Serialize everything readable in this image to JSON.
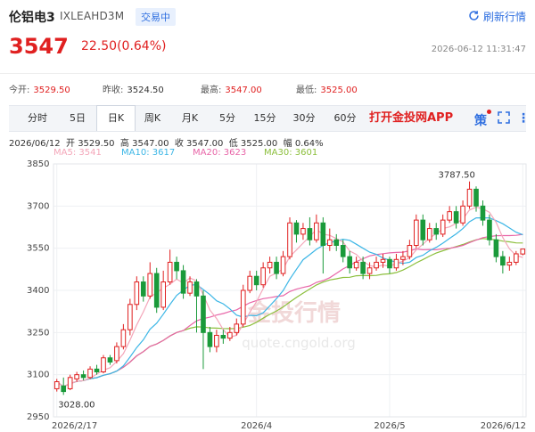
{
  "header": {
    "title": "伦铝电3",
    "code": "IXLEAHD3M",
    "status_badge": "交易中",
    "refresh_label": "刷新行情"
  },
  "quote": {
    "price": "3547",
    "change": "22.50(0.64%)",
    "timestamp": "2026-06-12 11:31:47",
    "open_label": "今开:",
    "open": "3529.50",
    "prev_close_label": "昨收:",
    "prev_close": "3524.50",
    "high_label": "最高:",
    "high": "3547.00",
    "low_label": "最低:",
    "low": "3525.00"
  },
  "tabs": [
    "分时",
    "5日",
    "日K",
    "周K",
    "月K",
    "5分",
    "15分",
    "30分",
    "60分"
  ],
  "active_tab": "日K",
  "app_link": "打开金投网APP",
  "kline_info": {
    "date": "2026/06/12",
    "open_label": "开",
    "open": "3529.50",
    "high_label": "高",
    "high": "3547.00",
    "close_label": "收",
    "close": "3547.00",
    "low_label": "低",
    "low": "3525.00",
    "amp_label": "幅",
    "amp": "0.64%"
  },
  "ma_legend": {
    "ma5": "MA5: 3541",
    "ma10": "MA10: 3617",
    "ma20": "MA20: 3623",
    "ma30": "MA30: 3601"
  },
  "watermark": {
    "text": "金投行情",
    "url": "quote.cngold.org"
  },
  "colors": {
    "up": "#e02020",
    "down": "#1a9a3a",
    "ma5": "#f4a6b9",
    "ma10": "#3cb6e6",
    "ma20": "#e866a8",
    "ma30": "#8cbf3c",
    "accent": "#2f6fe0"
  },
  "chart_data": {
    "type": "candlestick",
    "ylim": [
      2950,
      3850
    ],
    "y_ticks": [
      2950,
      3100,
      3250,
      3400,
      3550,
      3700,
      3850
    ],
    "x_labels": [
      {
        "index": 0,
        "label": "2026/2/17"
      },
      {
        "index": 30,
        "label": "2026/4"
      },
      {
        "index": 50,
        "label": "2026/5"
      },
      {
        "index": 70,
        "label": "2026/6/12"
      }
    ],
    "max_annotation": {
      "index": 62,
      "value": "3787.50"
    },
    "min_annotation": {
      "index": 1,
      "value": "3028.00"
    },
    "candles": [
      [
        3050,
        3075,
        3040,
        3085
      ],
      [
        3060,
        3040,
        3028,
        3090
      ],
      [
        3050,
        3090,
        3045,
        3100
      ],
      [
        3085,
        3100,
        3075,
        3110
      ],
      [
        3100,
        3090,
        3080,
        3115
      ],
      [
        3090,
        3120,
        3085,
        3130
      ],
      [
        3120,
        3110,
        3100,
        3135
      ],
      [
        3110,
        3160,
        3105,
        3170
      ],
      [
        3160,
        3145,
        3135,
        3170
      ],
      [
        3150,
        3200,
        3140,
        3215
      ],
      [
        3200,
        3260,
        3190,
        3280
      ],
      [
        3260,
        3350,
        3240,
        3370
      ],
      [
        3350,
        3430,
        3330,
        3450
      ],
      [
        3430,
        3380,
        3360,
        3450
      ],
      [
        3380,
        3460,
        3370,
        3500
      ],
      [
        3460,
        3340,
        3320,
        3480
      ],
      [
        3340,
        3430,
        3330,
        3470
      ],
      [
        3430,
        3500,
        3420,
        3545
      ],
      [
        3500,
        3470,
        3440,
        3520
      ],
      [
        3470,
        3390,
        3370,
        3490
      ],
      [
        3390,
        3430,
        3380,
        3450
      ],
      [
        3430,
        3380,
        3250,
        3440
      ],
      [
        3380,
        3250,
        3120,
        3400
      ],
      [
        3250,
        3200,
        3180,
        3270
      ],
      [
        3200,
        3240,
        3180,
        3260
      ],
      [
        3240,
        3230,
        3210,
        3260
      ],
      [
        3230,
        3250,
        3220,
        3270
      ],
      [
        3250,
        3280,
        3240,
        3300
      ],
      [
        3280,
        3400,
        3270,
        3420
      ],
      [
        3400,
        3450,
        3390,
        3470
      ],
      [
        3450,
        3420,
        3400,
        3470
      ],
      [
        3420,
        3480,
        3410,
        3500
      ],
      [
        3480,
        3500,
        3460,
        3520
      ],
      [
        3500,
        3460,
        3440,
        3520
      ],
      [
        3460,
        3520,
        3450,
        3540
      ],
      [
        3520,
        3640,
        3510,
        3660
      ],
      [
        3640,
        3600,
        3570,
        3650
      ],
      [
        3600,
        3620,
        3580,
        3640
      ],
      [
        3620,
        3580,
        3560,
        3660
      ],
      [
        3580,
        3640,
        3570,
        3670
      ],
      [
        3640,
        3560,
        3460,
        3660
      ],
      [
        3560,
        3580,
        3540,
        3620
      ],
      [
        3580,
        3560,
        3540,
        3600
      ],
      [
        3560,
        3520,
        3500,
        3580
      ],
      [
        3520,
        3480,
        3460,
        3540
      ],
      [
        3480,
        3500,
        3470,
        3520
      ],
      [
        3500,
        3460,
        3440,
        3520
      ],
      [
        3460,
        3480,
        3440,
        3500
      ],
      [
        3480,
        3500,
        3470,
        3520
      ],
      [
        3500,
        3510,
        3480,
        3530
      ],
      [
        3510,
        3480,
        3460,
        3520
      ],
      [
        3480,
        3510,
        3470,
        3530
      ],
      [
        3510,
        3520,
        3490,
        3540
      ],
      [
        3520,
        3560,
        3510,
        3580
      ],
      [
        3560,
        3650,
        3550,
        3670
      ],
      [
        3650,
        3580,
        3560,
        3670
      ],
      [
        3580,
        3620,
        3570,
        3640
      ],
      [
        3620,
        3600,
        3580,
        3640
      ],
      [
        3600,
        3650,
        3590,
        3670
      ],
      [
        3650,
        3680,
        3640,
        3700
      ],
      [
        3680,
        3640,
        3620,
        3700
      ],
      [
        3640,
        3700,
        3630,
        3720
      ],
      [
        3700,
        3760,
        3690,
        3787.5
      ],
      [
        3760,
        3700,
        3680,
        3770
      ],
      [
        3700,
        3650,
        3630,
        3720
      ],
      [
        3650,
        3580,
        3560,
        3670
      ],
      [
        3580,
        3520,
        3500,
        3600
      ],
      [
        3520,
        3490,
        3460,
        3540
      ],
      [
        3490,
        3500,
        3470,
        3520
      ],
      [
        3500,
        3530,
        3490,
        3540
      ],
      [
        3529.5,
        3547,
        3525,
        3547
      ]
    ]
  }
}
